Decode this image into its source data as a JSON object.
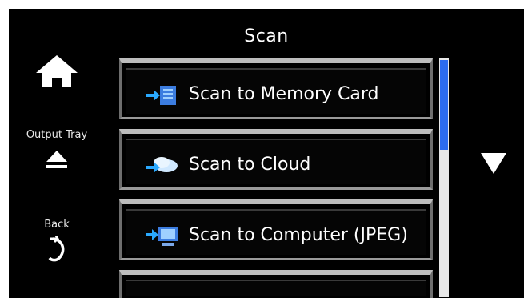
{
  "header": {
    "title": "Scan"
  },
  "sidebar": {
    "home": {
      "icon": "home-icon"
    },
    "output_tray": {
      "label": "Output Tray",
      "icon": "eject-icon"
    },
    "back": {
      "label": "Back",
      "icon": "back-arrow-icon"
    }
  },
  "menu": {
    "items": [
      {
        "label": "Scan to Memory Card",
        "icon": "memory-card-icon"
      },
      {
        "label": "Scan to Cloud",
        "icon": "cloud-icon"
      },
      {
        "label": "Scan to Computer (JPEG)",
        "icon": "computer-icon"
      }
    ]
  },
  "scroll": {
    "icon": "scroll-down-icon"
  },
  "colors": {
    "accent": "#2c6cf0",
    "background": "#000000",
    "item_border": "#bdbdbd"
  }
}
